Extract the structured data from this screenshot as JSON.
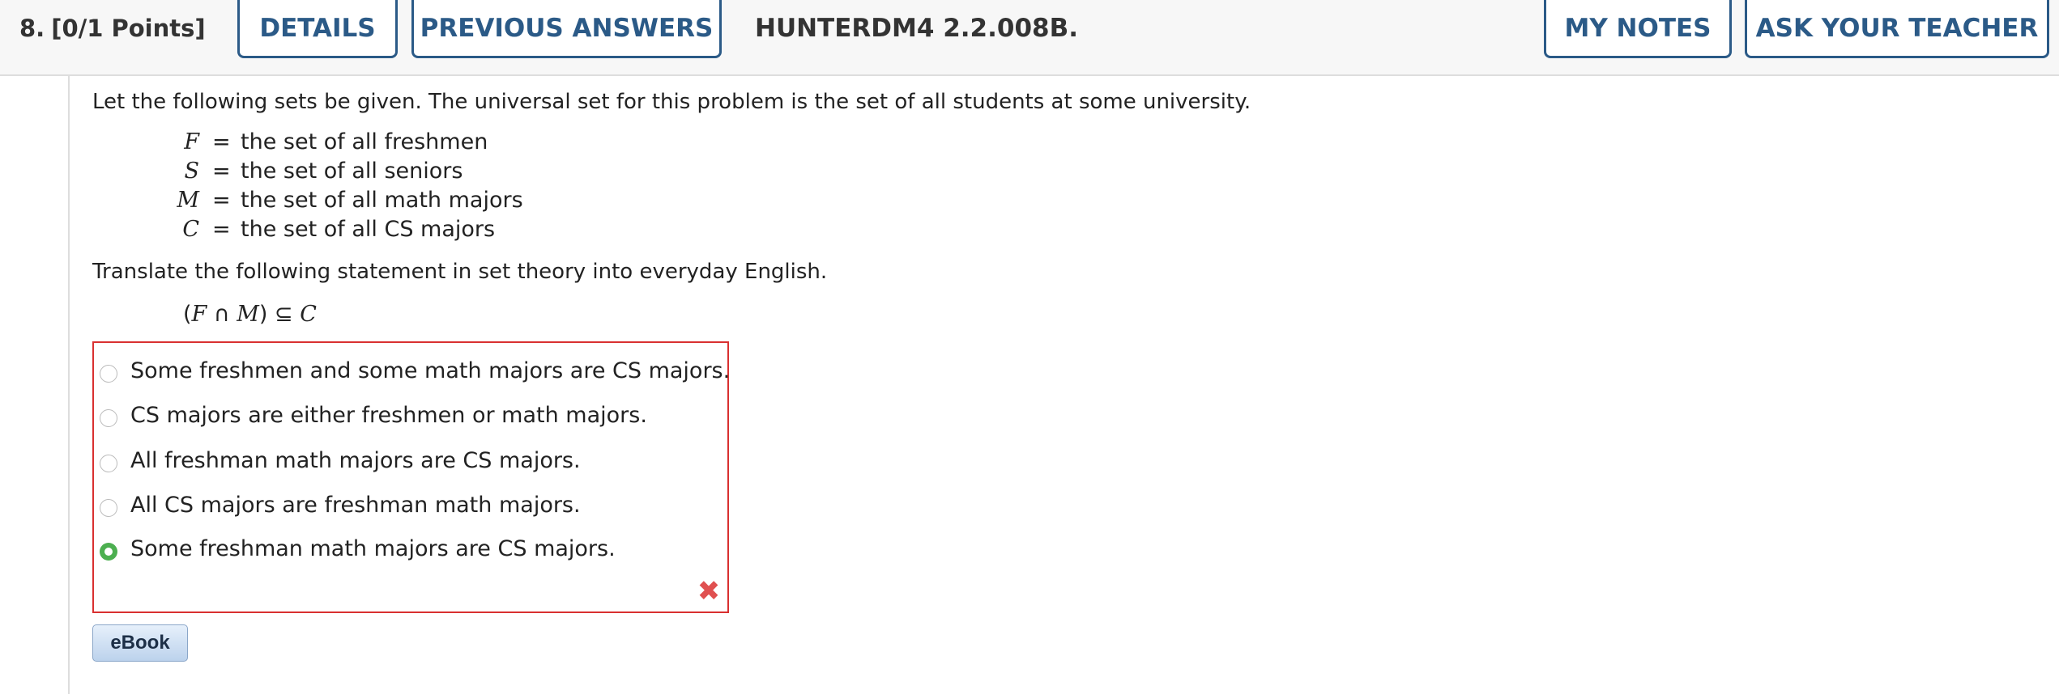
{
  "header": {
    "question_number": "8.",
    "points": "[0/1 Points]",
    "details_label": "DETAILS",
    "previous_answers_label": "PREVIOUS ANSWERS",
    "question_id": "HUNTERDM4 2.2.008B.",
    "my_notes_label": "MY NOTES",
    "ask_teacher_label": "ASK YOUR TEACHER",
    "accent_color": "#2b5a87"
  },
  "problem": {
    "intro": "Let the following sets be given. The universal set for this problem is the set of all students at some university.",
    "sets": [
      {
        "symbol": "F",
        "eq": "=",
        "description": "the set of all freshmen"
      },
      {
        "symbol": "S",
        "eq": "=",
        "description": "the set of all seniors"
      },
      {
        "symbol": "M",
        "eq": "=",
        "description": "the set of all math majors"
      },
      {
        "symbol": "C",
        "eq": "=",
        "description": "the set of all CS majors"
      }
    ],
    "instruction": "Translate the following statement in set theory into everyday English.",
    "expression": {
      "open_paren": "(",
      "left": "F",
      "intersect": "∩",
      "right": "M",
      "close_paren": ")",
      "subset": "⊆",
      "target": "C"
    }
  },
  "answers": {
    "options": [
      {
        "label": "Some freshmen and some math majors are CS majors.",
        "selected": false
      },
      {
        "label": "CS majors are either freshmen or math majors.",
        "selected": false
      },
      {
        "label": "All freshman math majors are CS majors.",
        "selected": false
      },
      {
        "label": "All CS majors are freshman math majors.",
        "selected": false
      },
      {
        "label": "Some freshman math majors are CS majors.",
        "selected": true
      }
    ],
    "status_icon": "incorrect-x-icon",
    "status_glyph": "✖",
    "border_color": "#d93030",
    "selected_color": "#4caf50"
  },
  "ebook": {
    "label": "eBook"
  }
}
